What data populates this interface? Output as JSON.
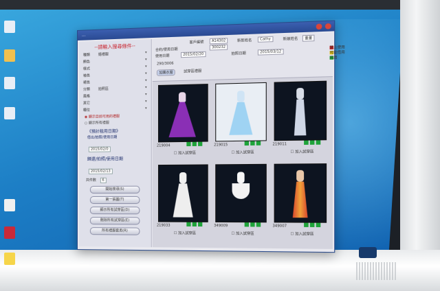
{
  "colors": {
    "accent_red": "#c8202a",
    "status_red": "#d21f1f",
    "status_yellow": "#e3c21a",
    "status_green": "#1fa33a"
  },
  "window": {
    "title": "..."
  },
  "left_panel": {
    "heading": "--請輸入搜尋條件--",
    "fields": [
      {
        "label": "種類",
        "value": "婚禮服",
        "icon": "dropdown-arrow"
      },
      {
        "label": "顏色",
        "value": "",
        "icon": "dropdown-arrow"
      },
      {
        "label": "樣式",
        "value": "",
        "icon": "dropdown-arrow"
      },
      {
        "label": "袖長",
        "value": "",
        "icon": "dropdown-arrow"
      },
      {
        "label": "裙長",
        "value": "",
        "icon": "dropdown-arrow"
      },
      {
        "label": "分類",
        "value": "拍照區",
        "icon": "dropdown-arrow"
      },
      {
        "label": "風格",
        "value": "",
        "icon": "dropdown-arrow"
      },
      {
        "label": "其它",
        "value": "",
        "icon": "dropdown-arrow"
      },
      {
        "label": "櫃位",
        "value": "",
        "icon": "dropdown-arrow"
      }
    ],
    "radio_1": "顯示目前可用的禮服",
    "radio_2": "顯示所有禮服",
    "section_1": "《預計租用日期》",
    "section_1_sub": "借出/拍照/使用日期",
    "date_1": "2015/02/0",
    "section_2": "歸還/拍照/使用日期",
    "date_2": "2015/02/13",
    "count_label": "共件數",
    "count_value": "6",
    "buttons": [
      "開始搜尋(S)",
      "第一張圖(T)",
      "顯示所有試穿區(D)",
      "刪除所有試穿區(E)",
      "所有禮服套用(R)"
    ]
  },
  "info_panel": {
    "label_1": "客戶編號",
    "value_1": "A14302",
    "label_2": "新郎姓名",
    "value_2": "Cathy",
    "label_3": "新娘姓名",
    "value_3": "董董",
    "label_4": "合約/使用日期",
    "value_4": "300232",
    "label_5": "使用日期",
    "value_5": "2015/02/20",
    "label_6": "拍照日期",
    "value_6": "2015/03/12",
    "extra_value": "290/3006",
    "button": "加購衣服",
    "try_label": "試穿區禮服",
    "legend": [
      {
        "label": "禁止使用",
        "color": "#d21f1f"
      },
      {
        "label": "可能借用",
        "color": "#e3c21a"
      },
      {
        "label": "可用",
        "color": "#1fa33a"
      }
    ]
  },
  "cards": [
    {
      "code": "219004",
      "label": "加入試穿區",
      "dress_color": "#8a2fb5"
    },
    {
      "code": "219015",
      "label": "加入試穿區",
      "dress_color": "#9fd3f3"
    },
    {
      "code": "219011",
      "label": "加入試穿區",
      "dress_color": "#cfd7e6"
    },
    {
      "code": "219033",
      "label": "加入試穿區",
      "dress_color": "#eeeeee"
    },
    {
      "code": "349009",
      "label": "加入試穿區",
      "dress_color": "#f2f2f2"
    },
    {
      "code": "349007",
      "label": "加入試穿區",
      "dress_color": "#d8472c"
    }
  ]
}
